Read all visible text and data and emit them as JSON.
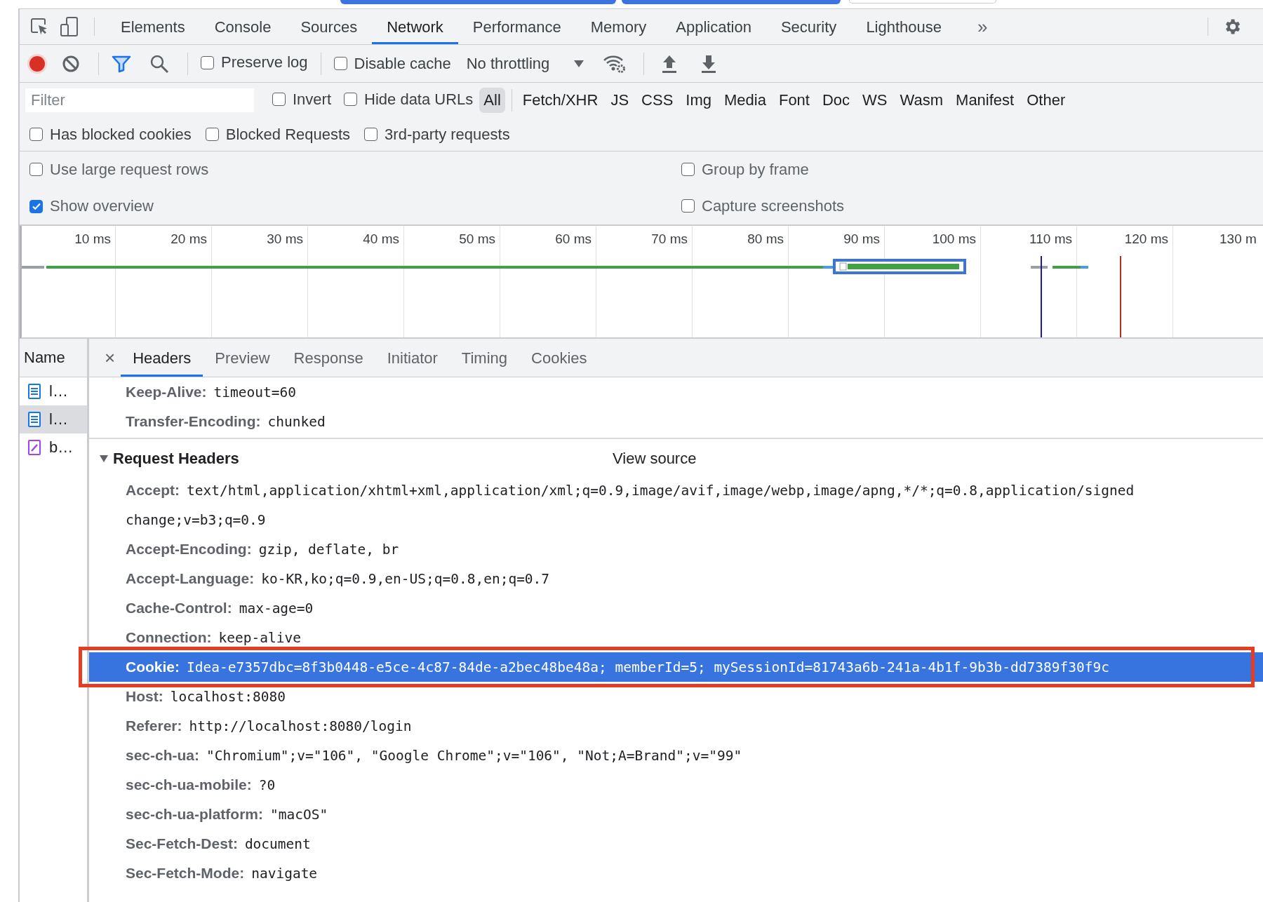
{
  "main_tabs": [
    {
      "label": "Elements",
      "selected": false
    },
    {
      "label": "Console",
      "selected": false
    },
    {
      "label": "Sources",
      "selected": false
    },
    {
      "label": "Network",
      "selected": true
    },
    {
      "label": "Performance",
      "selected": false
    },
    {
      "label": "Memory",
      "selected": false
    },
    {
      "label": "Application",
      "selected": false
    },
    {
      "label": "Security",
      "selected": false
    },
    {
      "label": "Lighthouse",
      "selected": false
    }
  ],
  "more_tabs": "»",
  "toolbar": {
    "recording": true,
    "preserve_log": {
      "label": "Preserve log",
      "checked": false
    },
    "disable_cache": {
      "label": "Disable cache",
      "checked": false
    },
    "throttling": "No throttling"
  },
  "filter": {
    "placeholder": "Filter",
    "invert": {
      "label": "Invert",
      "checked": false
    },
    "hide_data_urls": {
      "label": "Hide data URLs",
      "checked": false
    },
    "types": [
      {
        "label": "All",
        "selected": true
      },
      {
        "label": "Fetch/XHR",
        "selected": false
      },
      {
        "label": "JS",
        "selected": false
      },
      {
        "label": "CSS",
        "selected": false
      },
      {
        "label": "Img",
        "selected": false
      },
      {
        "label": "Media",
        "selected": false
      },
      {
        "label": "Font",
        "selected": false
      },
      {
        "label": "Doc",
        "selected": false
      },
      {
        "label": "WS",
        "selected": false
      },
      {
        "label": "Wasm",
        "selected": false
      },
      {
        "label": "Manifest",
        "selected": false
      },
      {
        "label": "Other",
        "selected": false
      }
    ]
  },
  "blocked_filters": [
    {
      "label": "Has blocked cookies",
      "checked": false
    },
    {
      "label": "Blocked Requests",
      "checked": false
    },
    {
      "label": "3rd-party requests",
      "checked": false
    }
  ],
  "settings": [
    {
      "label": "Use large request rows",
      "checked": false
    },
    {
      "label": "Group by frame",
      "checked": false
    },
    {
      "label": "Show overview",
      "checked": true
    },
    {
      "label": "Capture screenshots",
      "checked": false
    }
  ],
  "timeline": {
    "ticks": [
      "10 ms",
      "20 ms",
      "30 ms",
      "40 ms",
      "50 ms",
      "60 ms",
      "70 ms",
      "80 ms",
      "90 ms",
      "100 ms",
      "110 ms",
      "120 ms",
      "130 m"
    ]
  },
  "requests": {
    "column": "Name",
    "items": [
      {
        "name": "l…",
        "kind": "document",
        "selected": false
      },
      {
        "name": "l…",
        "kind": "document",
        "selected": true
      },
      {
        "name": "b…",
        "kind": "stylesheet",
        "selected": false
      }
    ]
  },
  "details": {
    "close": "×",
    "tabs": [
      {
        "label": "Headers",
        "selected": true
      },
      {
        "label": "Preview",
        "selected": false
      },
      {
        "label": "Response",
        "selected": false
      },
      {
        "label": "Initiator",
        "selected": false
      },
      {
        "label": "Timing",
        "selected": false
      },
      {
        "label": "Cookies",
        "selected": false
      }
    ],
    "response_headers": [
      {
        "name": "Keep-Alive:",
        "value": "timeout=60"
      },
      {
        "name": "Transfer-Encoding:",
        "value": "chunked"
      }
    ],
    "request_headers": {
      "title": "Request Headers",
      "expanded": true,
      "view_source": "View source",
      "headers": [
        {
          "name": "Accept:",
          "value": "text/html,application/xhtml+xml,application/xml;q=0.9,image/avif,image/webp,image/apng,*/*;q=0.8,application/signed",
          "continued": "change;v=b3;q=0.9",
          "highlighted": false,
          "boxed": false
        },
        {
          "name": "Accept-Encoding:",
          "value": "gzip, deflate, br",
          "highlighted": false,
          "boxed": false
        },
        {
          "name": "Accept-Language:",
          "value": "ko-KR,ko;q=0.9,en-US;q=0.8,en;q=0.7",
          "highlighted": false,
          "boxed": false
        },
        {
          "name": "Cache-Control:",
          "value": "max-age=0",
          "highlighted": false,
          "boxed": false
        },
        {
          "name": "Connection:",
          "value": "keep-alive",
          "highlighted": false,
          "boxed": false
        },
        {
          "name": "Cookie:",
          "value": "Idea-e7357dbc=8f3b0448-e5ce-4c87-84de-a2bec48be48a; memberId=5; mySessionId=81743a6b-241a-4b1f-9b3b-dd7389f30f9c",
          "highlighted": true,
          "boxed": true
        },
        {
          "name": "Host:",
          "value": "localhost:8080",
          "highlighted": false,
          "boxed": false
        },
        {
          "name": "Referer:",
          "value": "http://localhost:8080/login",
          "highlighted": false,
          "boxed": false
        },
        {
          "name": "sec-ch-ua:",
          "value": "\"Chromium\";v=\"106\", \"Google Chrome\";v=\"106\", \"Not;A=Brand\";v=\"99\"",
          "highlighted": false,
          "boxed": false
        },
        {
          "name": "sec-ch-ua-mobile:",
          "value": "?0",
          "highlighted": false,
          "boxed": false
        },
        {
          "name": "sec-ch-ua-platform:",
          "value": "\"macOS\"",
          "highlighted": false,
          "boxed": false
        },
        {
          "name": "Sec-Fetch-Dest:",
          "value": "document",
          "highlighted": false,
          "boxed": false
        },
        {
          "name": "Sec-Fetch-Mode:",
          "value": "navigate",
          "highlighted": false,
          "boxed": false
        }
      ]
    }
  }
}
